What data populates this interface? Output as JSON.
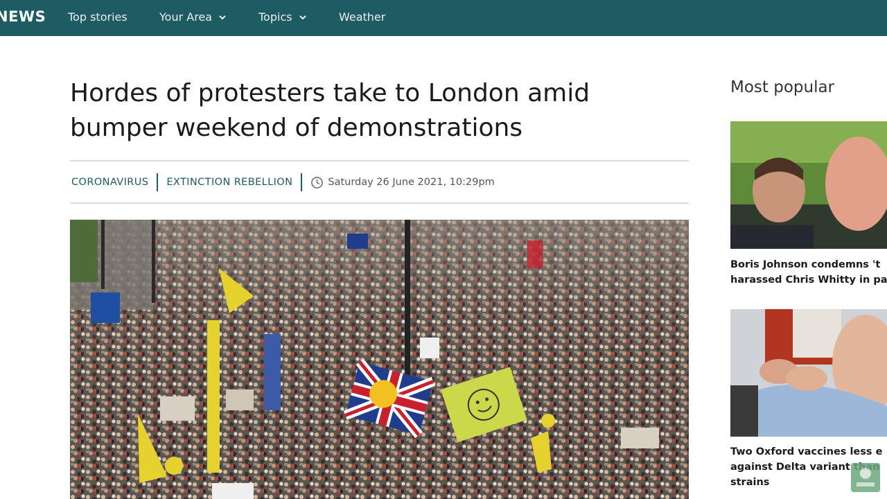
{
  "nav": {
    "brand": "NEWS",
    "items": [
      {
        "label": "Top stories",
        "dropdown": false
      },
      {
        "label": "Your Area",
        "dropdown": true
      },
      {
        "label": "Topics",
        "dropdown": true
      },
      {
        "label": "Weather",
        "dropdown": false
      }
    ]
  },
  "article": {
    "headline": "Hordes of protesters take to London amid bumper weekend of demonstrations",
    "tags": [
      "CORONAVIRUS",
      "EXTINCTION REBELLION"
    ],
    "timestamp": "Saturday 26 June 2021, 10:29pm",
    "hero_image": "protest-crowd-photo"
  },
  "sidebar": {
    "title": "Most popular",
    "stories": [
      {
        "caption_line1": "Boris Johnson condemns 't",
        "caption_line2": "harassed Chris Whitty in pa",
        "image": "two-men-photo"
      },
      {
        "caption_line1": "Two Oxford vaccines less e",
        "caption_line2": "against Delta variant than",
        "caption_line3": "strains",
        "image": "vaccination-photo"
      }
    ]
  },
  "colors": {
    "nav_bg": "#1d5c63",
    "tag_color": "#1d5c63",
    "rule": "#d9d9d9"
  }
}
